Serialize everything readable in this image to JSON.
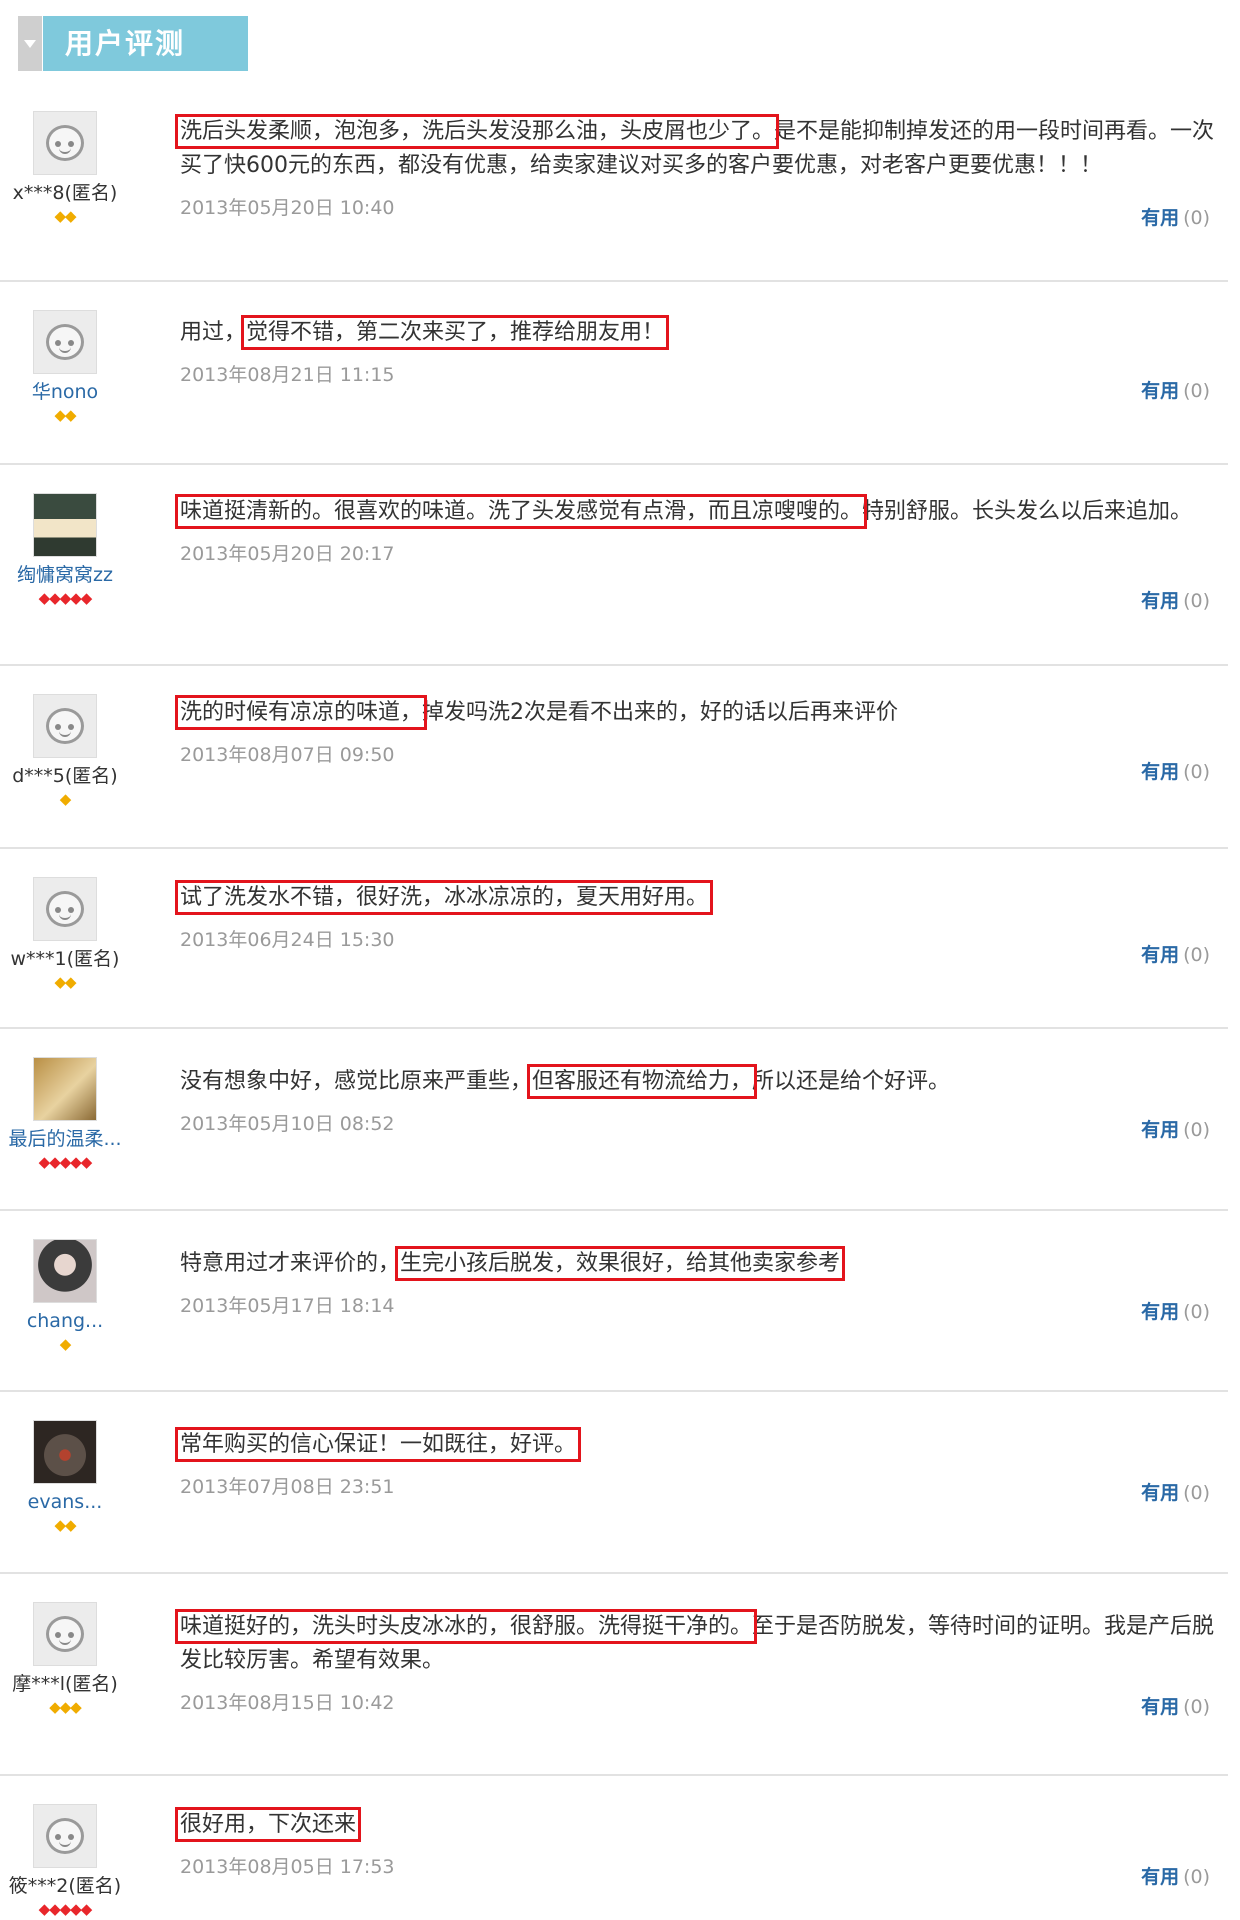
{
  "section_title": "用户评测",
  "useful_label": "有用",
  "reviews": [
    {
      "user": "x***8(匿名)",
      "user_type": "anon",
      "badge_text": "◆◆",
      "badge_color": "yellow",
      "parts": [
        "",
        "洗后头发柔顺，泡泡多，洗后头发没那么油，头皮屑也少了。",
        "是不是能抑制掉发还的用一段时间再看。一次买了快600元的东西，都没有优惠，给卖家建议对买多的客户要优惠，对老客户更要优惠！！！"
      ],
      "date": "2013年05月20日 10:40",
      "useful_count": "(0)"
    },
    {
      "user": "华nono",
      "user_type": "member",
      "badge_text": "◆◆",
      "badge_color": "yellow",
      "parts": [
        "用过，",
        "觉得不错，第二次来买了，推荐给朋友用！",
        ""
      ],
      "date": "2013年08月21日 11:15",
      "useful_count": "(0)"
    },
    {
      "user": "绹慵窝窝zz",
      "user_type": "member",
      "badge_text": "◆◆◆◆◆",
      "badge_color": "red",
      "parts": [
        "",
        "味道挺清新的。很喜欢的味道。洗了头发感觉有点滑，而且凉嗖嗖的。",
        "特别舒服。长头发么以后来追加。"
      ],
      "date": "2013年05月20日 20:17",
      "useful_count": "(0)"
    },
    {
      "user": "d***5(匿名)",
      "user_type": "anon",
      "badge_text": "◆",
      "badge_color": "yellow",
      "parts": [
        "",
        "洗的时候有凉凉的味道，",
        "掉发吗洗2次是看不出来的，好的话以后再来评价"
      ],
      "date": "2013年08月07日 09:50",
      "useful_count": "(0)"
    },
    {
      "user": "w***1(匿名)",
      "user_type": "anon",
      "badge_text": "◆◆",
      "badge_color": "yellow",
      "parts": [
        "",
        "试了洗发水不错，很好洗，冰冰凉凉的，夏天用好用。",
        ""
      ],
      "date": "2013年06月24日 15:30",
      "useful_count": "(0)"
    },
    {
      "user": "最后的温柔...",
      "user_type": "member",
      "badge_text": "◆◆◆◆◆",
      "badge_color": "red",
      "parts": [
        "没有想象中好，感觉比原来严重些，",
        "但客服还有物流给力，",
        "所以还是给个好评。"
      ],
      "date": "2013年05月10日 08:52",
      "useful_count": "(0)"
    },
    {
      "user": "chang...",
      "user_type": "member",
      "badge_text": "◆",
      "badge_color": "yellow",
      "parts": [
        "特意用过才来评价的，",
        "生完小孩后脱发，效果很好，给其他卖家参考",
        ""
      ],
      "date": "2013年05月17日 18:14",
      "useful_count": "(0)"
    },
    {
      "user": "evans...",
      "user_type": "member",
      "badge_text": "◆◆",
      "badge_color": "yellow",
      "parts": [
        "",
        "常年购买的信心保证！一如既往，好评。",
        ""
      ],
      "date": "2013年07月08日 23:51",
      "useful_count": "(0)"
    },
    {
      "user": "摩***l(匿名)",
      "user_type": "anon",
      "badge_text": "◆◆◆",
      "badge_color": "yellow",
      "parts": [
        "",
        "味道挺好的，洗头时头皮冰冰的，很舒服。洗得挺干净的。",
        "至于是否防脱发，等待时间的证明。我是产后脱发比较厉害。希望有效果。"
      ],
      "date": "2013年08月15日 10:42",
      "useful_count": "(0)"
    },
    {
      "user": "筱***2(匿名)",
      "user_type": "anon",
      "badge_text": "◆◆◆◆◆",
      "badge_color": "red",
      "parts": [
        "",
        "很好用，下次还来",
        ""
      ],
      "date": "2013年08月05日 17:53",
      "useful_count": "(0)"
    }
  ]
}
